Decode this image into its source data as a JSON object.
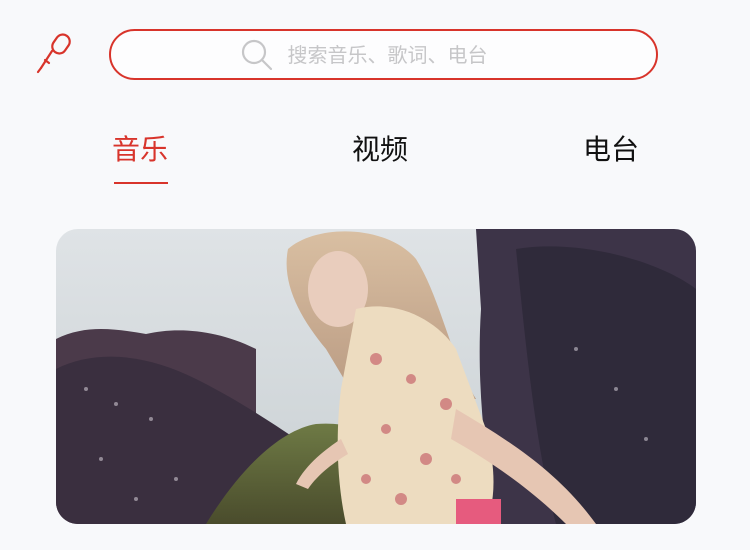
{
  "header": {
    "mic_icon": "microphone-icon",
    "search": {
      "icon": "search-icon",
      "placeholder": "搜索音乐、歌词、电台",
      "value": ""
    }
  },
  "tabs": [
    {
      "label": "音乐",
      "active": true
    },
    {
      "label": "视频",
      "active": false
    },
    {
      "label": "电台",
      "active": false
    }
  ],
  "colors": {
    "accent": "#d8342b",
    "background": "#f8f9fb",
    "placeholder": "#c6c6c8"
  },
  "banner": {
    "description_icon": "photo-banner"
  }
}
